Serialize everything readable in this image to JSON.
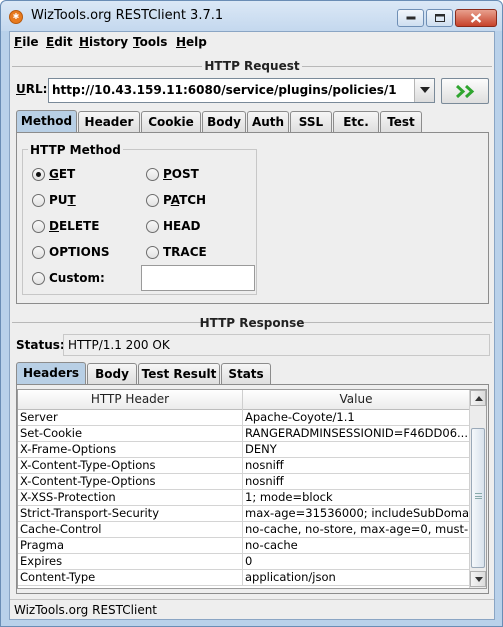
{
  "window": {
    "title": "WizTools.org RESTClient 3.7.1"
  },
  "menu": [
    {
      "pre": "",
      "u": "F",
      "post": "ile"
    },
    {
      "pre": "",
      "u": "E",
      "post": "dit"
    },
    {
      "pre": "",
      "u": "H",
      "post": "istory"
    },
    {
      "pre": "",
      "u": "T",
      "post": "ools"
    },
    {
      "pre": "",
      "u": "H",
      "post": "elp"
    }
  ],
  "request": {
    "section_title": "HTTP Request",
    "url_label_u": "U",
    "url_label_rest": "RL:",
    "url_value": "http://10.43.159.11:6080/service/plugins/policies/1",
    "tabs": [
      "Method",
      "Header",
      "Cookie",
      "Body",
      "Auth",
      "SSL",
      "Etc.",
      "Test"
    ],
    "active_tab": "Method",
    "method_group_title": "HTTP Method",
    "methods": [
      {
        "pre": "",
        "u": "G",
        "post": "ET",
        "checked": true
      },
      {
        "pre": "",
        "u": "P",
        "post": "OST",
        "checked": false
      },
      {
        "pre": "PU",
        "u": "T",
        "post": "",
        "checked": false
      },
      {
        "pre": "P",
        "u": "A",
        "post": "TCH",
        "checked": false
      },
      {
        "pre": "",
        "u": "D",
        "post": "ELETE",
        "checked": false
      },
      {
        "pre": "HEAD",
        "u": "",
        "post": "",
        "checked": false
      },
      {
        "pre": "OPTIONS",
        "u": "",
        "post": "",
        "checked": false
      },
      {
        "pre": "TRACE",
        "u": "",
        "post": "",
        "checked": false
      },
      {
        "pre": "Custom:",
        "u": "",
        "post": "",
        "checked": false
      }
    ],
    "custom_value": ""
  },
  "response": {
    "section_title": "HTTP Response",
    "status_label": "Status:",
    "status_value": "HTTP/1.1 200 OK",
    "tabs": [
      "Headers",
      "Body",
      "Test Result",
      "Stats"
    ],
    "active_tab": "Headers",
    "table_columns": [
      "HTTP Header",
      "Value"
    ],
    "table_rows": [
      [
        "Server",
        "Apache-Coyote/1.1"
      ],
      [
        "Set-Cookie",
        "RANGERADMINSESSIONID=F46DD06..."
      ],
      [
        "X-Frame-Options",
        "DENY"
      ],
      [
        "X-Content-Type-Options",
        "nosniff"
      ],
      [
        "X-Content-Type-Options",
        "nosniff"
      ],
      [
        "X-XSS-Protection",
        "1; mode=block"
      ],
      [
        "Strict-Transport-Security",
        "max-age=31536000; includeSubDoma..."
      ],
      [
        "Cache-Control",
        "no-cache, no-store, max-age=0, must-r..."
      ],
      [
        "Pragma",
        "no-cache"
      ],
      [
        "Expires",
        "0"
      ],
      [
        "Content-Type",
        "application/json"
      ]
    ]
  },
  "statusbar": {
    "text": "WizTools.org RESTClient"
  },
  "colors": {
    "active_tab": "#b8cfe5",
    "go_arrow": "#2fa52f",
    "app_icon": "#e87a1e",
    "close_button": "#c7422a"
  }
}
